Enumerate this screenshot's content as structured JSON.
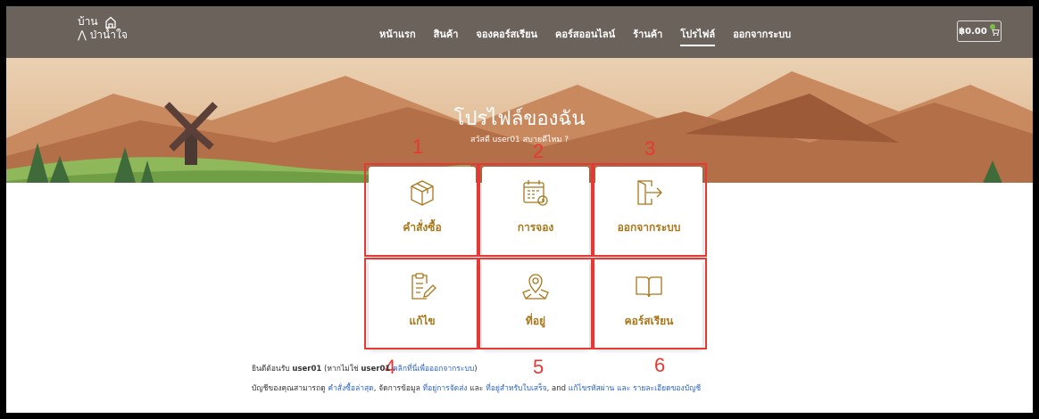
{
  "header": {
    "logo_line1": "บ้าน",
    "logo_line2": "ป่าน้ำใจ",
    "nav": [
      "หน้าแรก",
      "สินค้า",
      "จองคอร์สเรียน",
      "คอร์สออนไลน์",
      "ร้านค้า",
      "โปรไฟล์",
      "ออกจากระบบ"
    ],
    "active_nav": "โปรไฟล์",
    "cart_amount": "฿0.00"
  },
  "hero": {
    "title": "โปรไฟล์ของฉัน",
    "subtitle": "สวัสดี user01 สบายดีไหม ?"
  },
  "cards": [
    {
      "label": "คำสั่งซื้อ",
      "icon": "package-box-icon",
      "annotation": "1"
    },
    {
      "label": "การจอง",
      "icon": "calendar-icon",
      "annotation": "2"
    },
    {
      "label": "ออกจากระบบ",
      "icon": "logout-icon",
      "annotation": "3"
    },
    {
      "label": "แก้ไข",
      "icon": "clipboard-edit-icon",
      "annotation": "4"
    },
    {
      "label": "ที่อยู่",
      "icon": "map-pin-icon",
      "annotation": "5"
    },
    {
      "label": "คอร์สเรียน",
      "icon": "book-icon",
      "annotation": "6"
    }
  ],
  "welcome": {
    "prefix": "ยินดีต้อนรับ",
    "user": "user01",
    "middle": "(หากไม่ใช่",
    "user2": "user01",
    "link": "คลิกที่นี่เพื่อออกจากระบบ",
    "suffix": ")"
  },
  "description": {
    "text1": "บัญชีของคุณสามารถดู",
    "link1": "คำสั่งซื้อล่าสุด",
    "text2": ", จัดการข้อมูล",
    "link2": "ที่อยู่การจัดส่ง",
    "text3": "และ",
    "link3": "ที่อยู่สำหรับใบเสร็จ",
    "text4": ", and",
    "link4": "แก้ไขรหัสผ่าน และ รายละเอียดของบัญชี"
  },
  "colors": {
    "accent": "#a8771a",
    "annotation": "#e53935",
    "navbar": "#6b625c",
    "link": "#2b64c5"
  }
}
